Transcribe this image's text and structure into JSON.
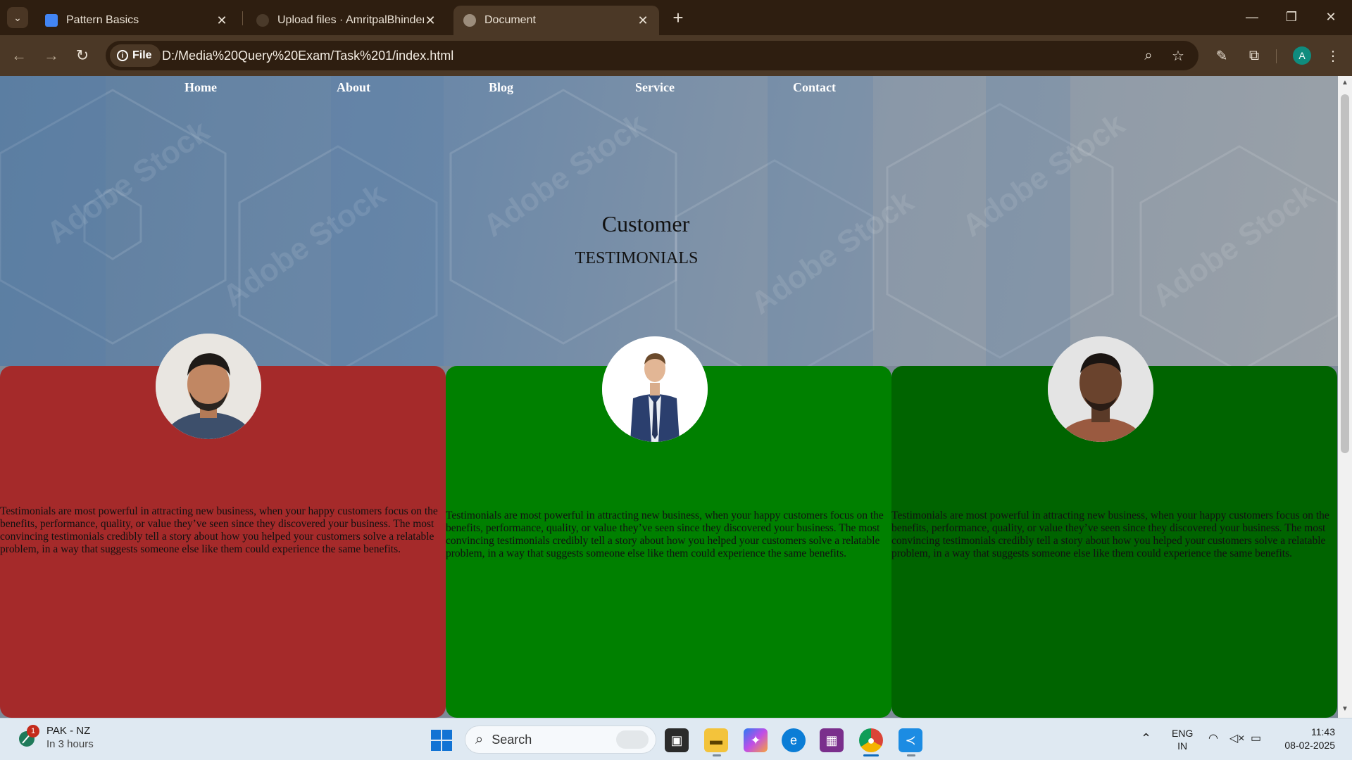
{
  "browser": {
    "tabs": [
      {
        "title": "Pattern Basics",
        "icon": "google-doc-icon",
        "active": false
      },
      {
        "title": "Upload files · AmritpalBhinder/",
        "icon": "github-icon",
        "active": false
      },
      {
        "title": "Document",
        "icon": "globe-icon",
        "active": true
      }
    ],
    "site_chip_label": "File",
    "url": "D:/Media%20Query%20Exam/Task%201/index.html",
    "profile_initial": "A"
  },
  "page": {
    "nav": [
      "Home",
      "About",
      "Blog",
      "Service",
      "Contact"
    ],
    "hero_title": "Customer",
    "hero_subtitle": "TESTIMONIALS",
    "cards": [
      {
        "color": "#a52a2a",
        "text": "Testimonials are most powerful in attracting new business, when your happy customers focus on the benefits, performance, quality, or value they’ve seen since they discovered your business. The most convincing testimonials credibly tell a story about how you helped your customers solve a relatable problem, in a way that suggests someone else like them could experience the same benefits."
      },
      {
        "color": "#008000",
        "text": "Testimonials are most powerful in attracting new business, when your happy customers focus on the benefits, performance, quality, or value they’ve seen since they discovered your business. The most convincing testimonials credibly tell a story about how you helped your customers solve a relatable problem, in a way that suggests someone else like them could experience the same benefits."
      },
      {
        "color": "#006400",
        "text": "Testimonials are most powerful in attracting new business, when your happy customers focus on the benefits, performance, quality, or value they’ve seen since they discovered your business. The most convincing testimonials credibly tell a story about how you helped your customers solve a relatable problem, in a way that suggests someone else like them could experience the same benefits."
      }
    ]
  },
  "taskbar": {
    "weather_title": "PAK - NZ",
    "weather_sub": "In 3 hours",
    "weather_badge": "1",
    "search_placeholder": "Search",
    "lang_top": "ENG",
    "lang_bottom": "IN",
    "time": "11:43",
    "date": "08-02-2025"
  }
}
